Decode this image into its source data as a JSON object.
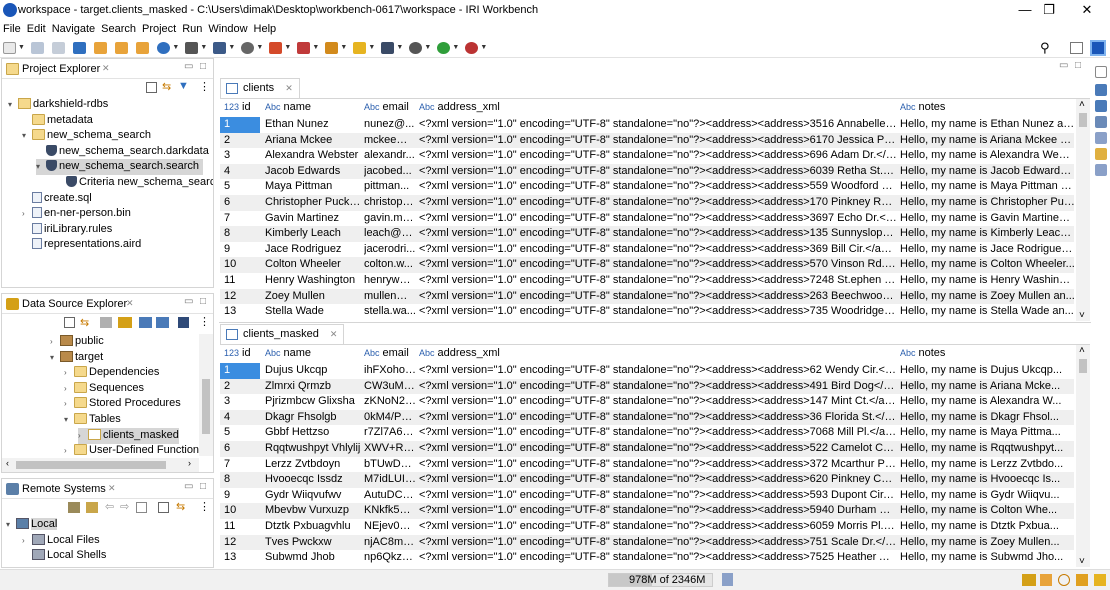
{
  "window": {
    "title": "workspace - target.clients_masked - C:\\Users\\dimak\\Desktop\\workbench-0617\\workspace - IRI Workbench",
    "min": "—",
    "max": "❐",
    "close": "✕"
  },
  "menu": [
    "File",
    "Edit",
    "Navigate",
    "Search",
    "Project",
    "Run",
    "Window",
    "Help"
  ],
  "project_explorer": {
    "title": "Project Explorer",
    "items": [
      {
        "label": "darkshield-rdbs",
        "depth": 0,
        "icon": "project-icon"
      },
      {
        "label": "metadata",
        "depth": 1,
        "icon": "folder-icon"
      },
      {
        "label": "new_schema_search",
        "depth": 1,
        "icon": "folder-open-icon"
      },
      {
        "label": "new_schema_search.darkdata",
        "depth": 2,
        "icon": "shield-icon"
      },
      {
        "label": "new_schema_search.search",
        "depth": 2,
        "icon": "shield-icon"
      },
      {
        "label": "Criteria new_schema_search",
        "depth": 3,
        "icon": "shield-icon"
      },
      {
        "label": "create.sql",
        "depth": 1,
        "icon": "file-icon"
      },
      {
        "label": "en-ner-person.bin",
        "depth": 1,
        "icon": "file-icon"
      },
      {
        "label": "iriLibrary.rules",
        "depth": 1,
        "icon": "file-icon"
      },
      {
        "label": "representations.aird",
        "depth": 1,
        "icon": "file-icon"
      }
    ]
  },
  "data_source_explorer": {
    "title": "Data Source Explorer",
    "items": [
      {
        "label": "public",
        "depth": 0
      },
      {
        "label": "target",
        "depth": 0
      },
      {
        "label": "Dependencies",
        "depth": 1
      },
      {
        "label": "Sequences",
        "depth": 1
      },
      {
        "label": "Stored Procedures",
        "depth": 1
      },
      {
        "label": "Tables",
        "depth": 1
      },
      {
        "label": "clients_masked",
        "depth": 2
      },
      {
        "label": "User-Defined Functions",
        "depth": 1
      }
    ]
  },
  "remote_systems": {
    "title": "Remote Systems",
    "items": [
      {
        "label": "Local",
        "depth": 0
      },
      {
        "label": "Local Files",
        "depth": 1
      },
      {
        "label": "Local Shells",
        "depth": 1
      }
    ]
  },
  "tables": [
    {
      "tab": "clients",
      "columns": [
        {
          "type": "123",
          "label": "id"
        },
        {
          "type": "Abc",
          "label": "name"
        },
        {
          "type": "Abc",
          "label": "email"
        },
        {
          "type": "Abc",
          "label": "address_xml"
        },
        {
          "type": "Abc",
          "label": "notes"
        }
      ],
      "rows": [
        [
          "1",
          "Ethan Nunez",
          "nunez@...",
          "<?xml version=\"1.0\" encoding=\"UTF-8\" standalone=\"no\"?><address><address>3516 Annabelle St.<...",
          "Hello, my name is Ethan Nunez an..."
        ],
        [
          "2",
          "Ariana Mckee",
          "mckee@...",
          "<?xml version=\"1.0\" encoding=\"UTF-8\" standalone=\"no\"?><address><address>6170 Jessica Pl.</ad...",
          "Hello, my name is Ariana Mckee a..."
        ],
        [
          "3",
          "Alexandra Webster",
          "alexandr...",
          "<?xml version=\"1.0\" encoding=\"UTF-8\" standalone=\"no\"?><address><address>696 Adam Dr.</addr...",
          "Hello, my name is Alexandra Webs..."
        ],
        [
          "4",
          "Jacob Edwards",
          "jacobed...",
          "<?xml version=\"1.0\" encoding=\"UTF-8\" standalone=\"no\"?><address><address>6039 Retha St.</add...",
          "Hello, my name is Jacob Edwards ..."
        ],
        [
          "5",
          "Maya Pittman",
          "pittman...",
          "<?xml version=\"1.0\" encoding=\"UTF-8\" standalone=\"no\"?><address><address>559 Woodford Ct.</...",
          "Hello, my name is Maya Pittman a..."
        ],
        [
          "6",
          "Christopher Puckett",
          "christoph...",
          "<?xml version=\"1.0\" encoding=\"UTF-8\" standalone=\"no\"?><address><address>170 Pinkney Rd.</a...",
          "Hello, my name is Christopher Puc..."
        ],
        [
          "7",
          "Gavin Martinez",
          "gavin.ma...",
          "<?xml version=\"1.0\" encoding=\"UTF-8\" standalone=\"no\"?><address><address>3697 Echo Dr.</add...",
          "Hello, my name is Gavin Martinez ..."
        ],
        [
          "8",
          "Kimberly Leach",
          "leach@m...",
          "<?xml version=\"1.0\" encoding=\"UTF-8\" standalone=\"no\"?><address><address>135 Sunnyslope Rd....",
          "Hello, my name is Kimberly Leach ..."
        ],
        [
          "9",
          "Jace Rodriguez",
          "jacerodri...",
          "<?xml version=\"1.0\" encoding=\"UTF-8\" standalone=\"no\"?><address><address>369 Bill Cir.</addres...",
          "Hello, my name is Jace Rodriguez ..."
        ],
        [
          "10",
          "Colton Wheeler",
          "colton.w...",
          "<?xml version=\"1.0\" encoding=\"UTF-8\" standalone=\"no\"?><address><address>570 Vinson Rd.</add...",
          "Hello, my name is Colton Wheeler..."
        ],
        [
          "11",
          "Henry Washington",
          "henrywas...",
          "<?xml version=\"1.0\" encoding=\"UTF-8\" standalone=\"no\"?><address><address>7248 St.ephen St.</...",
          "Hello, my name is Henry Washingt..."
        ],
        [
          "12",
          "Zoey Mullen",
          "mullen@...",
          "<?xml version=\"1.0\" encoding=\"UTF-8\" standalone=\"no\"?><address><address>263 Beechwood Dr....",
          "Hello, my name is Zoey Mullen an..."
        ],
        [
          "13",
          "Stella Wade",
          "stella.wa...",
          "<?xml version=\"1.0\" encoding=\"UTF-8\" standalone=\"no\"?><address><address>735 Woodridge Dr.<...",
          "Hello, my name is Stella Wade an..."
        ]
      ]
    },
    {
      "tab": "clients_masked",
      "columns": [
        {
          "type": "123",
          "label": "id"
        },
        {
          "type": "Abc",
          "label": "name"
        },
        {
          "type": "Abc",
          "label": "email"
        },
        {
          "type": "Abc",
          "label": "address_xml"
        },
        {
          "type": "Abc",
          "label": "notes"
        }
      ],
      "rows": [
        [
          "1",
          "Dujus Ukcqp",
          "ihFXohoS...",
          "<?xml version=\"1.0\" encoding=\"UTF-8\" standalone=\"no\"?><address><address>62 Wendy Cir.</add...",
          "Hello, my name is Dujus Ukcqp..."
        ],
        [
          "2",
          "Zlmrxi Qrmzb",
          "CW3uMp...",
          "<?xml version=\"1.0\" encoding=\"UTF-8\" standalone=\"no\"?><address><address>491 Bird Dog</addr...",
          "Hello, my name is Ariana Mcke..."
        ],
        [
          "3",
          "Pjrizmbcw Glixsha",
          "zKNoN2s...",
          "<?xml version=\"1.0\" encoding=\"UTF-8\" standalone=\"no\"?><address><address>147 Mint Ct.</addr...",
          "Hello, my name is Alexandra W..."
        ],
        [
          "4",
          "Dkagr Fhsolgb",
          "0kM4/P1r...",
          "<?xml version=\"1.0\" encoding=\"UTF-8\" standalone=\"no\"?><address><address>36 Florida St.</addr...",
          "Hello, my name is Dkagr Fhsol..."
        ],
        [
          "5",
          "Gbbf Hettzso",
          "r7Zl7A6C...",
          "<?xml version=\"1.0\" encoding=\"UTF-8\" standalone=\"no\"?><address><address>7068 Mill Pl.</addr...",
          "Hello, my name is Maya Pittma..."
        ],
        [
          "6",
          "Rqqtwushpyt Vhlylij",
          "XWV+RGI...",
          "<?xml version=\"1.0\" encoding=\"UTF-8\" standalone=\"no\"?><address><address>522 Camelot Ct.</a...",
          "Hello, my name is Rqqtwushpyt..."
        ],
        [
          "7",
          "Lerzz Zvtbdoyn",
          "bTUwDba...",
          "<?xml version=\"1.0\" encoding=\"UTF-8\" standalone=\"no\"?><address><address>372 Mcarthur Pond...",
          "Hello, my name is Lerzz Zvtbdo..."
        ],
        [
          "8",
          "Hvooecqc Issdz",
          "M7idLUI0...",
          "<?xml version=\"1.0\" encoding=\"UTF-8\" standalone=\"no\"?><address><address>620 Pinkney Church...",
          "Hello, my name is Hvooecqc Is..."
        ],
        [
          "9",
          "Gydr Wiiqvufwv",
          "AutuDCLs...",
          "<?xml version=\"1.0\" encoding=\"UTF-8\" standalone=\"no\"?><address><address>593 Dupont Cir.</a...",
          "Hello, my name is Gydr Wiiqvu..."
        ],
        [
          "10",
          "Mbevbw Vurxuzp",
          "KNkfk52g...",
          "<?xml version=\"1.0\" encoding=\"UTF-8\" standalone=\"no\"?><address><address>5940 Durham St.</a...",
          "Hello, my name is Colton Whe..."
        ],
        [
          "11",
          "Dtztk Pxbuagvhlu",
          "NEjev0AY...",
          "<?xml version=\"1.0\" encoding=\"UTF-8\" standalone=\"no\"?><address><address>6059 Morris Pl.</add...",
          "Hello, my name is Dtztk Pxbua..."
        ],
        [
          "12",
          "Tves Pwckxw",
          "njAC8mA...",
          "<?xml version=\"1.0\" encoding=\"UTF-8\" standalone=\"no\"?><address><address>751 Scale Dr.</addr...",
          "Hello, my name is Zoey Mullen..."
        ],
        [
          "13",
          "Subwmd Jhob",
          "np6Qkz7...",
          "<?xml version=\"1.0\" encoding=\"UTF-8\" standalone=\"no\"?><address><address>7525 Heather Ann<...",
          "Hello, my name is Subwmd Jho..."
        ]
      ]
    }
  ],
  "status": {
    "memory": "978M of 2346M",
    "memory_fraction": 0.417
  },
  "colors": {
    "accent": "#3b8de0",
    "folder": "#f5d98c"
  }
}
